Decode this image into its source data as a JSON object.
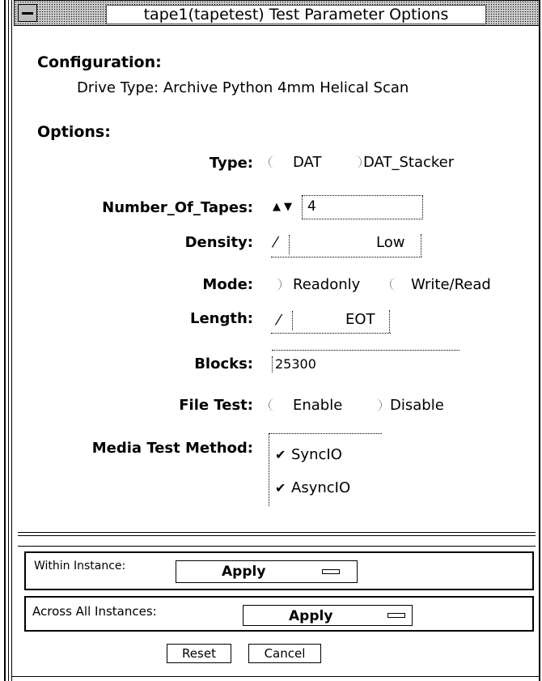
{
  "window": {
    "title": "tape1(tapetest) Test Parameter Options"
  },
  "configuration": {
    "heading": "Configuration:",
    "drive_type": "Drive Type: Archive Python 4mm Helical Scan"
  },
  "options": {
    "heading": "Options:",
    "type": {
      "label": "Type:",
      "choices": [
        "DAT",
        "DAT_Stacker"
      ]
    },
    "number_of_tapes": {
      "label": "Number_Of_Tapes:",
      "value": "4"
    },
    "density": {
      "label": "Density:",
      "value": "Low"
    },
    "mode": {
      "label": "Mode:",
      "choices": [
        "Readonly",
        "Write/Read"
      ]
    },
    "length": {
      "label": "Length:",
      "value": "EOT"
    },
    "blocks": {
      "label": "Blocks:",
      "value": "25300"
    },
    "file_test": {
      "label": "File Test:",
      "choices": [
        "Enable",
        "Disable"
      ]
    },
    "media_test_method": {
      "label": "Media Test Method:",
      "choices": [
        {
          "label": "SyncIO",
          "checked": true
        },
        {
          "label": "AsyncIO",
          "checked": true
        }
      ]
    }
  },
  "footer": {
    "within_instance": {
      "label": "Within Instance:",
      "button": "Apply"
    },
    "across_all_instances": {
      "label": "Across All Instances:",
      "button": "Apply"
    },
    "reset": "Reset",
    "cancel": "Cancel"
  }
}
